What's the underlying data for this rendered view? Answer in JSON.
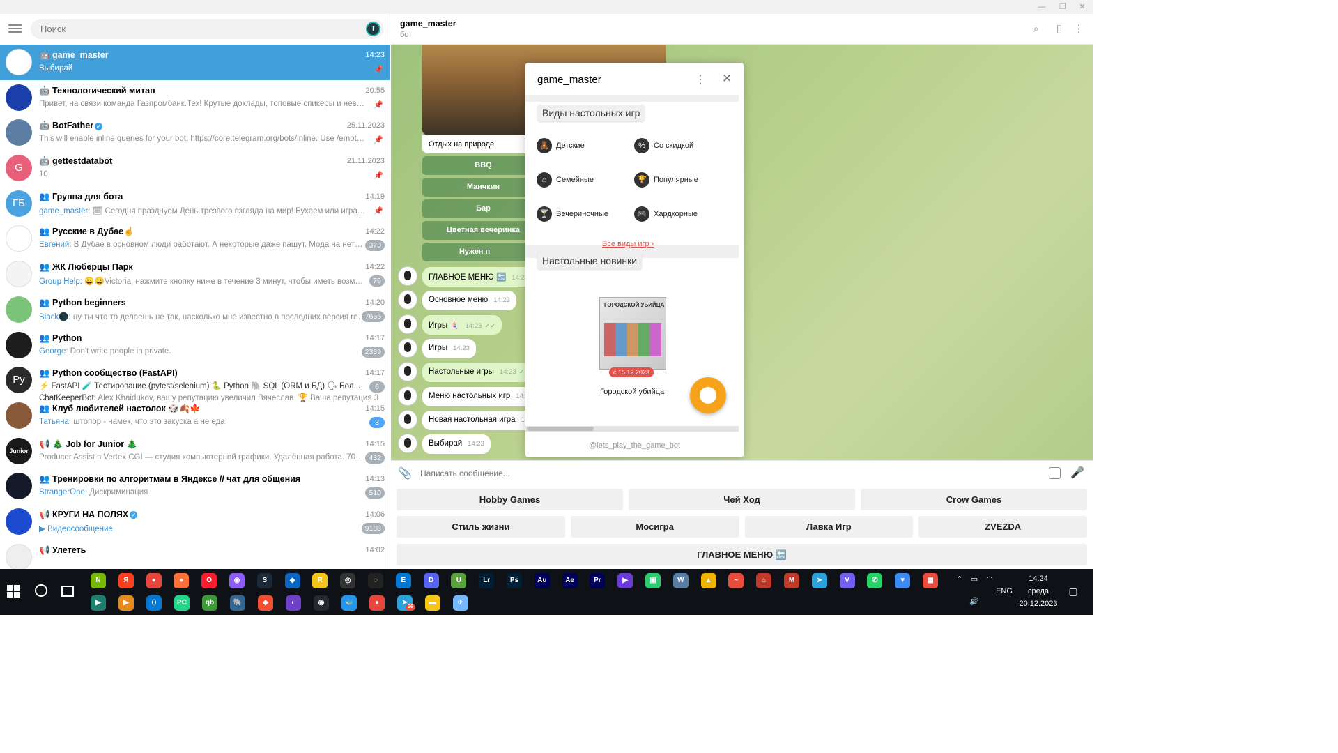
{
  "search": {
    "placeholder": "Поиск"
  },
  "header": {
    "title": "game_master",
    "subtitle": "бот"
  },
  "chats": [
    {
      "name": "🤖 game_master",
      "time": "14:23",
      "preview": "Выбирай",
      "pinned": true,
      "avatar_color": "#ffffff"
    },
    {
      "name": "🤖 Технологический митап",
      "time": "20:55",
      "preview": "Привет, на связи команда Газпромбанк.Тех!  Крутые доклады, топовые спикеры и невероятно атмосферное...",
      "pinned": true,
      "avatar_color": "#1a3fa8"
    },
    {
      "name": "🤖 BotFather",
      "time": "25.11.2023",
      "preview": "This will enable inline queries for your bot. https://core.telegram.org/bots/inline. Use /empty to disable...",
      "pinned": true,
      "verified": true,
      "avatar_color": "#5d7ea3"
    },
    {
      "name": "🤖 gettestdatabot",
      "time": "21.11.2023",
      "preview": "10",
      "pinned": true,
      "avatar_color": "#e8607a",
      "avatar_text": "G"
    },
    {
      "name": "👥 Группа для бота",
      "time": "14:19",
      "sender": "game_master:",
      "preview": "🗓 Сегодня празднуем День трезвого взгляда на мир! Бухаем или играем?",
      "pinned": true,
      "avatar_color": "#4aa3df",
      "avatar_text": "ГБ"
    },
    {
      "name": "👥 Русские в Дубае☝",
      "time": "14:22",
      "sender": "Евгений:",
      "preview": "В Дубае в основном люди работают. А некоторые даже пашут. Мода на нетворк...",
      "badge": "373",
      "avatar_color": "#ffffff"
    },
    {
      "name": "👥 ЖК Люберцы Парк",
      "time": "14:22",
      "sender": "Group Help:",
      "preview": "😀😀Victoria,  нажмите кнопку ниже в течение 3 минут, чтобы иметь возмож...",
      "badge": "79",
      "avatar_color": "#f4f4f4"
    },
    {
      "name": "👥 Python beginners",
      "time": "14:20",
      "sender": "Black🌑:",
      "preview": "ну ты что то делаешь не так, насколько мне известно в последних версия reque...",
      "badge": "7656",
      "avatar_color": "#7cc47a"
    },
    {
      "name": "👥 Python",
      "time": "14:17",
      "sender": "George:",
      "preview": "Don't write people in private.",
      "badge": "2339",
      "avatar_color": "#1d1d1d"
    },
    {
      "name": "👥 Python сообщество (FastAPI)",
      "time": "14:17",
      "topics": "⚡ FastAPI  🧪 Тестирование (pytest/selenium)  🐍 Python  🐘 SQL (ORM и БД)  🗣 Бол...",
      "topic_line2_sender": "ChatKeeperBot:",
      "topic_line2": "Alex Khaidukov, вашу репутацию увеличил Вячеслав. 🏆 Ваша репутация 3...",
      "badge": "6",
      "avatar_color": "#2a2a2a",
      "avatar_text": "Py"
    },
    {
      "name": "👥 Клуб любителей настолок 🎲🍂🍁",
      "time": "14:15",
      "sender": "Татьяна:",
      "preview": "штопор - намек, что это закуска а не еда",
      "badge": "3",
      "badge_blue": true,
      "avatar_color": "#8a5a3a"
    },
    {
      "name": "📢 🎄 Job for Junior 🎄",
      "time": "14:15",
      "preview": "Producer Assist в Vertex CGI — студия компьютерной графики. Удалённая работа. 70K. Опи...",
      "badge": "432",
      "avatar_color": "#1a1a1a",
      "avatar_text": "Junior"
    },
    {
      "name": "👥 Тренировки по алгоритмам в Яндексе // чат для общения",
      "time": "14:13",
      "sender": "StrangerOne:",
      "preview": "Дискриминация",
      "badge": "510",
      "avatar_color": "#151a2a"
    },
    {
      "name": "📢 КРУГИ НА ПОЛЯХ",
      "time": "14:06",
      "preview": "▶ Видеосообщение",
      "preview_blue": true,
      "badge": "9188",
      "verified": true,
      "avatar_color": "#1c4bd0"
    },
    {
      "name": "📢 Улететь",
      "time": "14:02",
      "preview": "",
      "avatar_color": "#eeeeee"
    }
  ],
  "conversation": {
    "photo_caption": "Отдых на природе",
    "inline_buttons": [
      "BBQ",
      "Манчкин",
      "Бар",
      "Цветная вечеринка",
      "Нужен п"
    ],
    "messages": [
      {
        "text": "ГЛАВНОЕ МЕНЮ 🔙",
        "time": "14:23",
        "out": true
      },
      {
        "text": "Основное меню",
        "time": "14:23",
        "out": false
      },
      {
        "text": "Игры 🃏",
        "time": "14:23",
        "out": true,
        "read": "✓✓"
      },
      {
        "text": "Игры",
        "time": "14:23",
        "out": false
      },
      {
        "text": "Настольные игры",
        "time": "14:23",
        "out": true,
        "read": "✓"
      },
      {
        "text": "Меню настольных игр",
        "time": "14:23",
        "out": false
      },
      {
        "text": "Новая настольная игра",
        "time": "14:23",
        "out": false
      },
      {
        "text": "Выбирай",
        "time": "14:23",
        "out": false
      }
    ]
  },
  "webapp": {
    "title": "game_master",
    "section1_title": "Виды настольных игр",
    "categories": [
      {
        "label": "Детские",
        "icon": "teddy-bear-icon",
        "glyph": "🧸"
      },
      {
        "label": "Со скидкой",
        "icon": "discount-icon",
        "glyph": "%"
      },
      {
        "label": "Семейные",
        "icon": "house-icon",
        "glyph": "⌂"
      },
      {
        "label": "Популярные",
        "icon": "trophy-icon",
        "glyph": "🏆"
      },
      {
        "label": "Вечериночные",
        "icon": "cocktail-icon",
        "glyph": "🍸"
      },
      {
        "label": "Хардкорные",
        "icon": "gamepad-icon",
        "glyph": "🎮"
      }
    ],
    "all_types_link": "Все виды игр",
    "section2_title": "Настольные новинки",
    "new_game": {
      "name": "Городской убийца",
      "date": "с 15.12.2023",
      "box_text": "ГОРОДСКОЙ УБИЙЦА"
    },
    "footer": "@lets_play_the_game_bot"
  },
  "input": {
    "placeholder": "Написать сообщение..."
  },
  "reply_keyboard": {
    "row1": [
      "Hobby Games",
      "Чей Ход",
      "Crow Games"
    ],
    "row2": [
      "Стиль жизни",
      "Мосигра",
      "Лавка Игр",
      "ZVEZDA"
    ],
    "row3": [
      "ГЛАВНОЕ МЕНЮ 🔙"
    ]
  },
  "taskbar": {
    "lang": "ENG",
    "time": "14:24",
    "day": "среда",
    "date": "20.12.2023",
    "apps_row1": [
      {
        "label": "N",
        "color": "#76b900",
        "icon": "nvidia-icon"
      },
      {
        "label": "Я",
        "color": "#fc3f1d",
        "icon": "yandex-browser-icon"
      },
      {
        "label": "●",
        "color": "#e8453c",
        "icon": "chrome-icon"
      },
      {
        "label": "●",
        "color": "#ff7139",
        "icon": "firefox-icon"
      },
      {
        "label": "O",
        "color": "#ff1b2d",
        "icon": "opera-icon"
      },
      {
        "label": "◉",
        "color": "#8b5cf6",
        "icon": "tor-icon"
      },
      {
        "label": "S",
        "color": "#1b2838",
        "icon": "steam-icon"
      },
      {
        "label": "◆",
        "color": "#0a66c2",
        "icon": "bing-icon"
      },
      {
        "label": "R",
        "color": "#f5c518",
        "icon": "rockstar-icon"
      },
      {
        "label": "◎",
        "color": "#333333",
        "icon": "obs-icon"
      },
      {
        "label": "◌",
        "color": "#222222",
        "icon": "circle-app-icon"
      },
      {
        "label": "E",
        "color": "#0078d4",
        "icon": "epic-icon"
      },
      {
        "label": "D",
        "color": "#5865f2",
        "icon": "discord-icon"
      },
      {
        "label": "U",
        "color": "#5aa33c",
        "icon": "utorrent-icon"
      },
      {
        "label": "Lr",
        "color": "#001e36",
        "icon": "lightroom-icon"
      },
      {
        "label": "Ps",
        "color": "#001e36",
        "icon": "photoshop-icon"
      },
      {
        "label": "Au",
        "color": "#00005b",
        "icon": "audition-icon"
      },
      {
        "label": "Ae",
        "color": "#00005b",
        "icon": "after-effects-icon"
      },
      {
        "label": "Pr",
        "color": "#00005b",
        "icon": "premiere-icon"
      },
      {
        "label": "▶",
        "color": "#6a3bd8",
        "icon": "video-app-icon"
      },
      {
        "label": "▣",
        "color": "#2ecc71",
        "icon": "green-app-icon"
      },
      {
        "label": "W",
        "color": "#5a7fa6",
        "icon": "warframe-icon"
      },
      {
        "label": "▲",
        "color": "#f0b400",
        "icon": "triangle-app-icon"
      },
      {
        "label": "~",
        "color": "#e74c3c",
        "icon": "anydesk-icon"
      },
      {
        "label": "⌂",
        "color": "#c0392b",
        "icon": "hood-app-icon"
      },
      {
        "label": "M",
        "color": "#c0392b",
        "icon": "red-app-icon"
      },
      {
        "label": "➤",
        "color": "#2aa3dd",
        "icon": "telegram-desktop-icon"
      },
      {
        "label": "V",
        "color": "#7360f2",
        "icon": "viber-icon"
      },
      {
        "label": "✆",
        "color": "#25d366",
        "icon": "whatsapp-icon"
      },
      {
        "label": "▼",
        "color": "#3d8bf2",
        "icon": "vpn-icon"
      },
      {
        "label": "▦",
        "color": "#e74c3c",
        "icon": "grid-app-icon"
      }
    ],
    "apps_row2": [
      {
        "label": "▶",
        "color": "#1e7f6e",
        "icon": "terminal-icon"
      },
      {
        "label": "▶",
        "color": "#e58b1e",
        "icon": "sublime-icon"
      },
      {
        "label": "⟨⟩",
        "color": "#0078d4",
        "icon": "vscode-icon"
      },
      {
        "label": "PC",
        "color": "#21d789",
        "icon": "pycharm-icon"
      },
      {
        "label": "qb",
        "color": "#3d9b37",
        "icon": "qbittorrent-icon"
      },
      {
        "label": "🐘",
        "color": "#336791",
        "icon": "postgres-icon"
      },
      {
        "label": "◆",
        "color": "#f14e32",
        "icon": "git-icon"
      },
      {
        "label": "◐",
        "color": "#6e40c9",
        "icon": "github-desktop-icon"
      },
      {
        "label": "◉",
        "color": "#24292e",
        "icon": "github-icon"
      },
      {
        "label": "🐳",
        "color": "#2496ed",
        "icon": "docker-icon"
      },
      {
        "label": "●",
        "color": "#e8453c",
        "icon": "chrome-icon-2"
      },
      {
        "label": "➤",
        "color": "#2aa3dd",
        "icon": "telegram-icon",
        "badge": "26"
      },
      {
        "label": "▬",
        "color": "#f5c518",
        "icon": "explorer-icon"
      },
      {
        "label": "✈",
        "color": "#74b9ff",
        "icon": "pilot-icon"
      }
    ]
  }
}
